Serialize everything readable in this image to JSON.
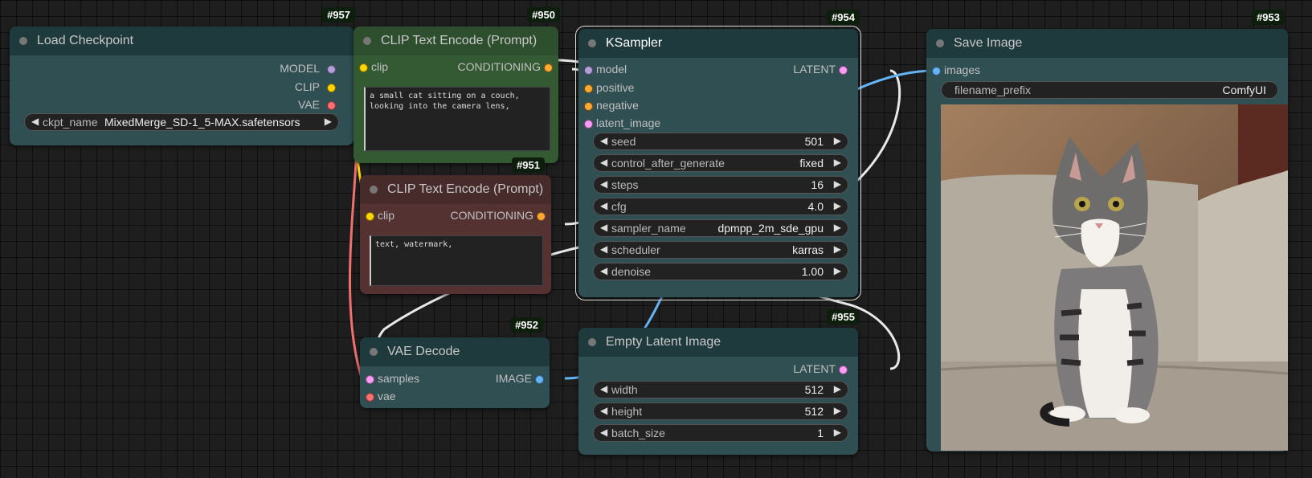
{
  "colors": {
    "model_pin": "#b39ddb",
    "clip_pin": "#ffd500",
    "vae_pin": "#ff6e6e",
    "conditioning_pin": "#ffa931",
    "latent_pin": "#ff9cf9",
    "image_pin": "#64b5f6"
  },
  "nodes": {
    "load_checkpoint": {
      "id": "#957",
      "title": "Load Checkpoint",
      "outputs": [
        "MODEL",
        "CLIP",
        "VAE"
      ],
      "ckpt_name_label": "ckpt_name",
      "ckpt_name_value": "MixedMerge_SD-1_5-MAX.safetensors"
    },
    "clip_pos": {
      "id": "#950",
      "title": "CLIP Text Encode (Prompt)",
      "input": "clip",
      "output": "CONDITIONING",
      "text": "a small cat sitting on a couch, looking into the camera lens,"
    },
    "clip_neg": {
      "id": "#951",
      "title": "CLIP Text Encode (Prompt)",
      "input": "clip",
      "output": "CONDITIONING",
      "text": "text, watermark,"
    },
    "ksampler": {
      "id": "#954",
      "title": "KSampler",
      "inputs": [
        "model",
        "positive",
        "negative",
        "latent_image"
      ],
      "output": "LATENT",
      "widgets": [
        {
          "name": "seed",
          "value": "501"
        },
        {
          "name": "control_after_generate",
          "value": "fixed"
        },
        {
          "name": "steps",
          "value": "16"
        },
        {
          "name": "cfg",
          "value": "4.0"
        },
        {
          "name": "sampler_name",
          "value": "dpmpp_2m_sde_gpu"
        },
        {
          "name": "scheduler",
          "value": "karras"
        },
        {
          "name": "denoise",
          "value": "1.00"
        }
      ]
    },
    "vae_decode": {
      "id": "#952",
      "title": "VAE Decode",
      "inputs": [
        "samples",
        "vae"
      ],
      "output": "IMAGE"
    },
    "empty_latent": {
      "id": "#955",
      "title": "Empty Latent Image",
      "output": "LATENT",
      "widgets": [
        {
          "name": "width",
          "value": "512"
        },
        {
          "name": "height",
          "value": "512"
        },
        {
          "name": "batch_size",
          "value": "1"
        }
      ]
    },
    "save_image": {
      "id": "#953",
      "title": "Save Image",
      "input": "images",
      "prefix_label": "filename_prefix",
      "prefix_value": "ComfyUI"
    }
  }
}
